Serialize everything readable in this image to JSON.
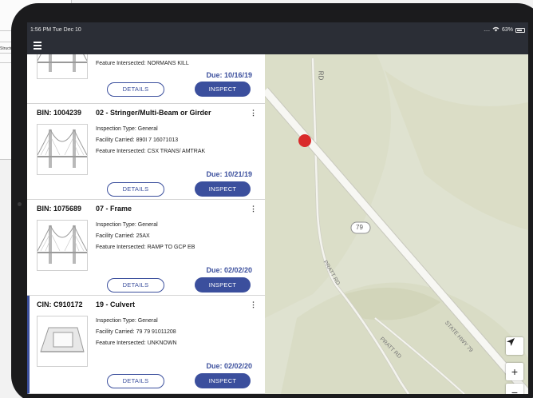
{
  "status_bar": {
    "time": "1:56 PM  Tue Dec 10",
    "signal": "....",
    "battery": "63%"
  },
  "paper": {
    "snippet": "Structur"
  },
  "cards": [
    {
      "feature_partial": "Feature Intersected: NORMANS KILL",
      "due": "Due: 10/16/19",
      "details_label": "DETAILS",
      "inspect_label": "INSPECT"
    },
    {
      "bin": "BIN: 1004239",
      "type": "02 - Stringer/Multi-Beam or Girder",
      "inspection_type": "Inspection Type: General",
      "facility": "Facility Carried: 890I 7 16071013",
      "feature": "Feature Intersected: CSX TRANS/ AMTRAK",
      "due": "Due: 10/21/19",
      "details_label": "DETAILS",
      "inspect_label": "INSPECT",
      "more": "⋮"
    },
    {
      "bin": "BIN: 1075689",
      "type": "07 - Frame",
      "inspection_type": "Inspection Type: General",
      "facility": "Facility Carried: 25AX",
      "feature": "Feature Intersected: RAMP TO GCP EB",
      "due": "Due: 02/02/20",
      "details_label": "DETAILS",
      "inspect_label": "INSPECT",
      "more": "⋮"
    },
    {
      "bin": "CIN: C910172",
      "type": "19 - Culvert",
      "inspection_type": "Inspection Type: General",
      "facility": "Facility Carried: 79 79 91011208",
      "feature": "Feature Intersected: UNKNOWN",
      "due": "Due: 02/02/20",
      "details_label": "DETAILS",
      "inspect_label": "INSPECT",
      "more": "⋮"
    }
  ],
  "map": {
    "labels": {
      "rd_top": "RD",
      "route_shield": "79",
      "pratt_rd_1": "PRATT RD",
      "pratt_rd_2": "PRATT RD",
      "state_hwy": "STATE HWY 79"
    },
    "controls": {
      "locate_icon": "navigation-arrow",
      "zoom_in": "+",
      "zoom_out": "−"
    },
    "marker_color": "#d92b2b"
  },
  "colors": {
    "accent": "#3b4f9d",
    "app_bar": "#2b2e36"
  }
}
